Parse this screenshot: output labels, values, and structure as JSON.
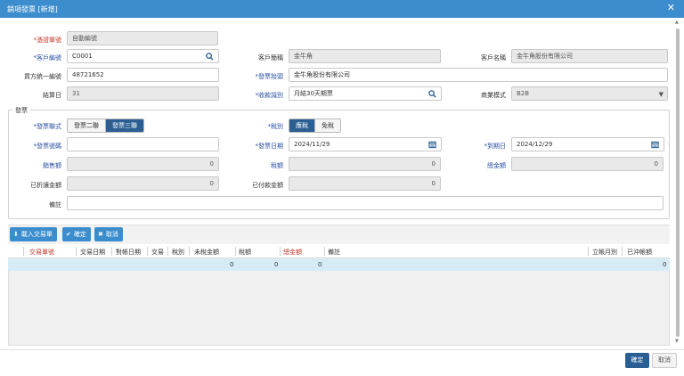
{
  "window": {
    "title": "銷項發票 [新增]",
    "close_glyph": "✕"
  },
  "form": {
    "bill_no": {
      "label": "*憑證單號",
      "value": "自動編號"
    },
    "customer_code": {
      "label": "*客戶編號",
      "value": "C0001"
    },
    "customer_short": {
      "label": "客戶簡稱",
      "value": "金牛角"
    },
    "customer_name": {
      "label": "客戶名稱",
      "value": "金牛角股份有限公司"
    },
    "buyer_tax_id": {
      "label": "買方統一編號",
      "value": "48721652"
    },
    "invoice_title": {
      "label": "*發票抬頭",
      "value": "金牛角股份有限公司"
    },
    "closing_day": {
      "label": "結算日",
      "value": "31"
    },
    "payment_terms": {
      "label": "*收款識別",
      "value": "月結30天期票"
    },
    "business_mode": {
      "label": "商業模式",
      "value": "B2B"
    }
  },
  "invoice": {
    "legend": "發票",
    "form_type": {
      "label": "*發票聯式",
      "options": [
        "發票二聯",
        "發票三聯"
      ],
      "active": 1
    },
    "tax_type": {
      "label": "*稅別",
      "options": [
        "應稅",
        "免稅"
      ],
      "active": 0
    },
    "invoice_no": {
      "label": "*發票號碼",
      "value": ""
    },
    "invoice_date": {
      "label": "*發票日期",
      "value": "2024/11/29"
    },
    "due_date": {
      "label": "*到期日",
      "value": "2024/12/29"
    },
    "sales_amount": {
      "label": "銷售額",
      "value": "0"
    },
    "tax_amount": {
      "label": "稅額",
      "value": "0"
    },
    "total_amount": {
      "label": "總金額",
      "value": "0"
    },
    "discounted_amount": {
      "label": "已折讓金額",
      "value": "0"
    },
    "paid_amount": {
      "label": "已付款金額",
      "value": "0"
    },
    "remark": {
      "label": "備註",
      "value": ""
    }
  },
  "toolbar": {
    "import_label": "載入交易單",
    "confirm_label": "確定",
    "cancel_label": "取消"
  },
  "grid": {
    "columns": [
      "交易單號",
      "交易日期",
      "對帳日期",
      "交易",
      "稅別",
      "未稅金額",
      "稅額",
      "總金額",
      "備註",
      "立帳月別",
      "已沖帳額"
    ],
    "summary": {
      "untaxed": "0",
      "tax": "0",
      "total": "0",
      "written_off": "0"
    }
  },
  "footer": {
    "ok_label": "確定",
    "cancel_label": "取消"
  },
  "colors": {
    "titlebar": "#3c8dcd",
    "primary": "#2b5f94",
    "required": "#c0392b",
    "label_blue": "#2a4fa0",
    "row_highlight": "#d7ebf7"
  }
}
